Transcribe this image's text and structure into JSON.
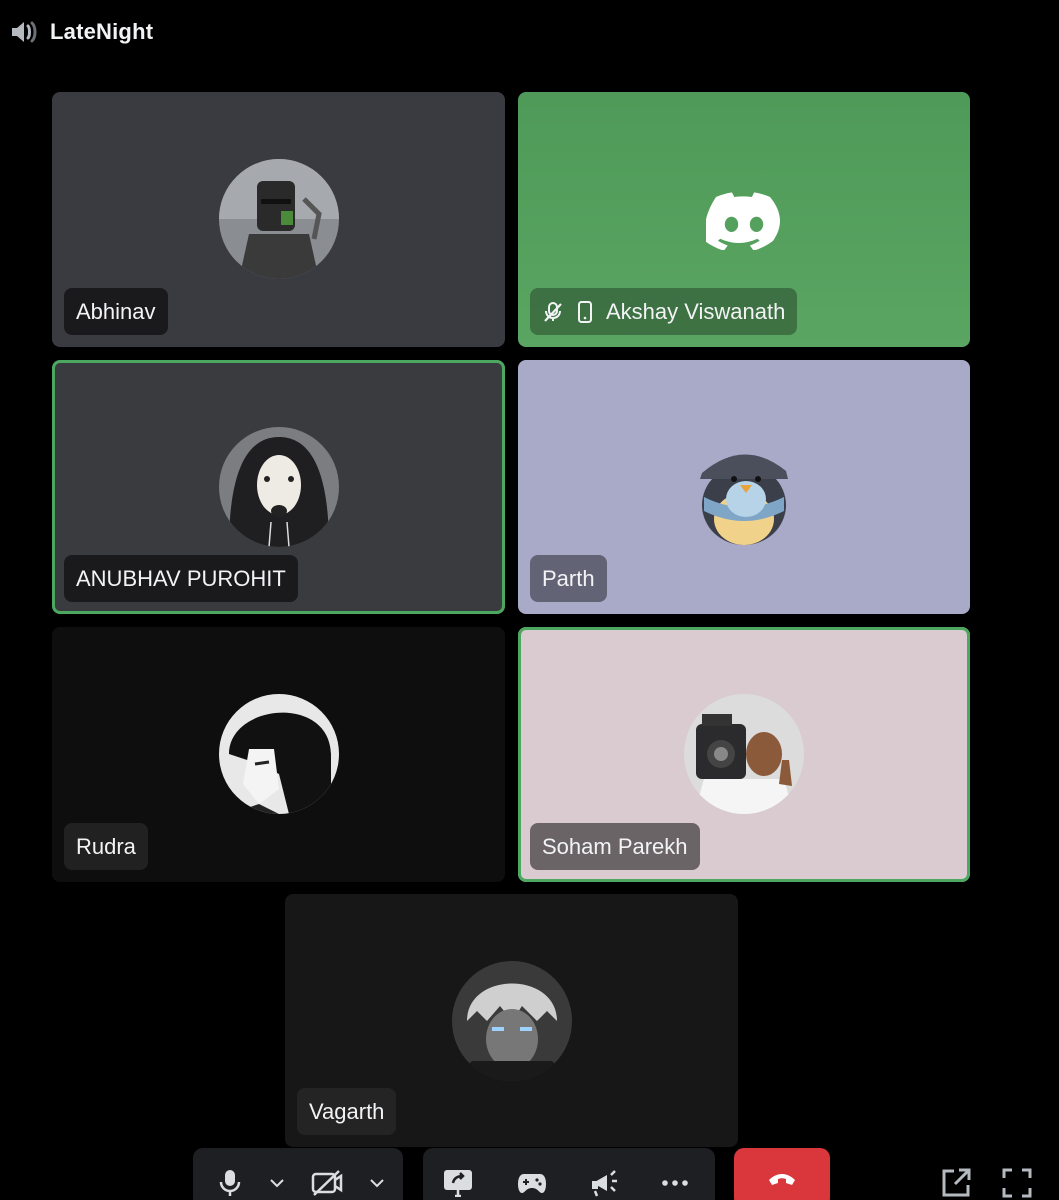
{
  "channel": {
    "name": "LateNight",
    "icon": "speaker-icon"
  },
  "participants": [
    {
      "name": "Abhinav",
      "speaking": false,
      "tile_color": "#3a3b40",
      "avatar": "knight-helmet-avatar"
    },
    {
      "name": "Akshay Viswanath",
      "speaking": false,
      "tile_color": "#57a35f",
      "avatar": "discord-logo-icon",
      "muted": true,
      "mobile": true
    },
    {
      "name": "ANUBHAV PUROHIT",
      "speaking": true,
      "tile_color": "#3a3b3e",
      "avatar": "hooded-dog-avatar"
    },
    {
      "name": "Parth",
      "speaking": false,
      "tile_color": "#a9aac8",
      "avatar": "penguin-with-cap-avatar"
    },
    {
      "name": "Rudra",
      "speaking": false,
      "tile_color": "#0e0e0e",
      "avatar": "anime-boy-avatar"
    },
    {
      "name": "Soham Parekh",
      "speaking": true,
      "tile_color": "#d9cbd0",
      "avatar": "camera-man-thumbs-up-avatar"
    },
    {
      "name": "Vagarth",
      "speaking": false,
      "tile_color": "#171718",
      "avatar": "anime-character-avatar"
    }
  ],
  "controls": {
    "mic": "microphone-icon",
    "camera": "camera-off-icon",
    "screen_share": "screen-share-icon",
    "activities": "gamepad-icon",
    "soundboard": "soundboard-icon",
    "more": "more-icon",
    "disconnect": "hang-up-icon",
    "popout": "pop-out-icon",
    "fullscreen": "fullscreen-icon"
  },
  "colors": {
    "speaking_ring": "#4ca860",
    "hangup": "#da373c",
    "control_bar": "#1e1f22",
    "accent_green": "#57a35f"
  }
}
